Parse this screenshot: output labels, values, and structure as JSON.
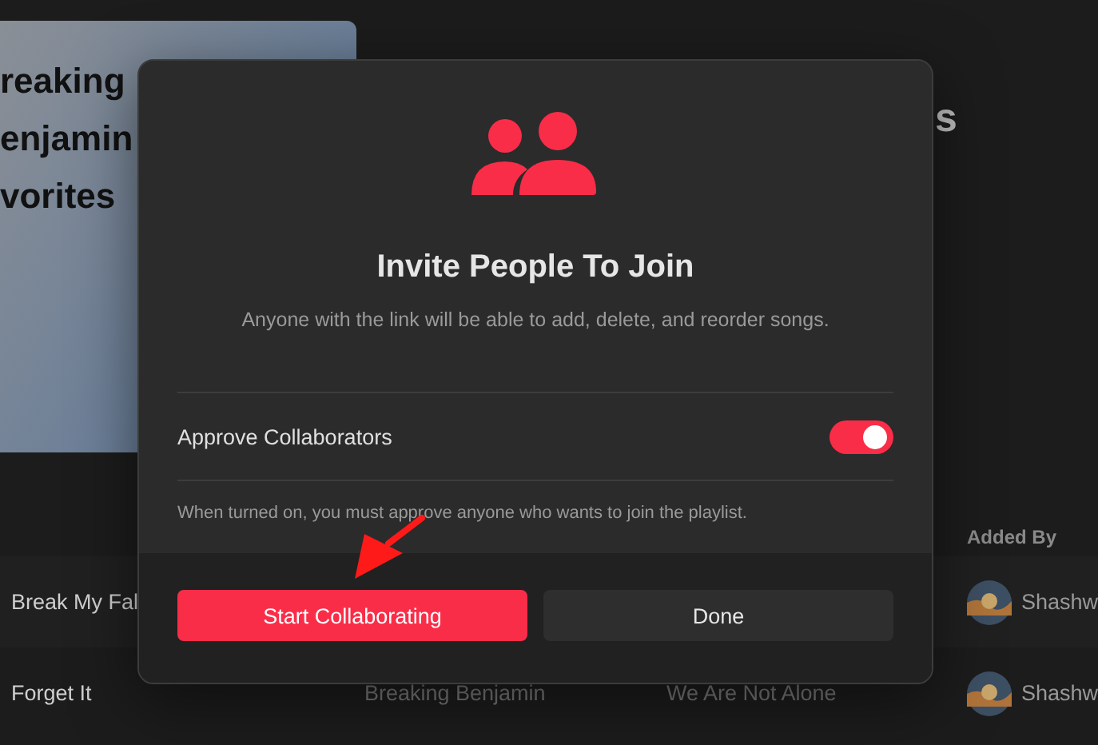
{
  "background": {
    "cover_lines": [
      "reaking",
      "enjamin",
      "vorites"
    ],
    "header_fragment": "s",
    "table": {
      "columns": [
        {
          "label": "Added By"
        }
      ],
      "rows": [
        {
          "title": "Break My Fal",
          "added_by": "Shashw"
        },
        {
          "title": "Forget It",
          "artist": "Breaking Benjamin",
          "album": "We Are Not Alone",
          "added_by": "Shashw"
        }
      ]
    }
  },
  "dialog": {
    "title": "Invite People To Join",
    "subtitle": "Anyone with the link will be able to add, delete, and reorder songs.",
    "setting": {
      "label": "Approve Collaborators",
      "on": true
    },
    "note": "When turned on, you must approve anyone who wants to join the playlist.",
    "buttons": [
      {
        "label": "Start Collaborating",
        "kind": "primary"
      },
      {
        "label": "Done",
        "kind": "secondary"
      }
    ]
  }
}
